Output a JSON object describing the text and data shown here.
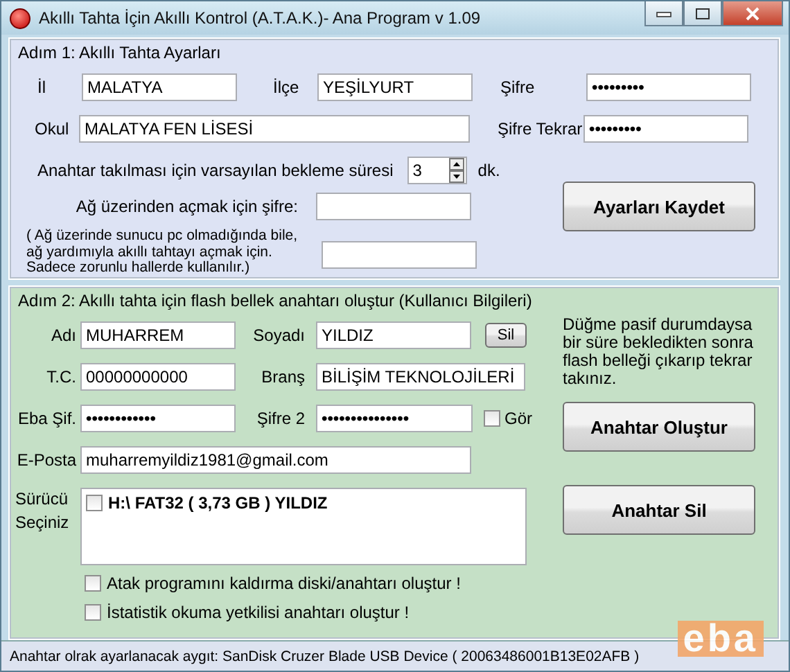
{
  "window": {
    "title": "Akıllı Tahta İçin Akıllı Kontrol (A.T.A.K.)- Ana Program v 1.09"
  },
  "step1": {
    "title": "Adım 1: Akıllı Tahta Ayarları",
    "il": {
      "label": "İl",
      "value": "MALATYA"
    },
    "ilce": {
      "label": "İlçe",
      "value": "YEŞİLYURT"
    },
    "sifre": {
      "label": "Şifre",
      "value": "•••••••••"
    },
    "okul": {
      "label": "Okul",
      "value": "MALATYA FEN LİSESİ"
    },
    "sifre_tekrar": {
      "label": "Şifre Tekrar",
      "value": "•••••••••"
    },
    "wait": {
      "label": "Anahtar takılması için varsayılan bekleme süresi",
      "value": "3",
      "unit": "dk."
    },
    "network": {
      "label": "Ağ üzerinden açmak için şifre:",
      "note": "( Ağ üzerinde sunucu pc olmadığında bile, ağ yardımıyla akıllı tahtayı açmak için. Sadece zorunlu hallerde kullanılır.)"
    },
    "save_button": "Ayarları Kaydet"
  },
  "step2": {
    "title": "Adım 2: Akıllı tahta için flash bellek anahtarı oluştur (Kullanıcı Bilgileri)",
    "adi": {
      "label": "Adı",
      "value": "MUHARREM"
    },
    "soyadi": {
      "label": "Soyadı",
      "value": "YILDIZ"
    },
    "clear_button": "Sil",
    "tc": {
      "label": "T.C.",
      "value": "00000000000"
    },
    "brans": {
      "label": "Branş",
      "value": "BİLİŞİM TEKNOLOJİLERİ"
    },
    "eba_sifre": {
      "label": "Eba Şif.",
      "value": "••••••••••••"
    },
    "sifre2": {
      "label": "Şifre 2",
      "value": "•••••••••••••••"
    },
    "show_password": {
      "label": "Gör",
      "checked": false
    },
    "eposta": {
      "label": "E-Posta",
      "value": "muharremyildiz1981@gmail.com"
    },
    "note": "Düğme pasif durumdaysa bir süre bekledikten sonra flash belleği çıkarıp tekrar takınız.",
    "create_button": "Anahtar Oluştur",
    "drive": {
      "label": "Sürücü Seçiniz",
      "items": [
        {
          "label": "H:\\ FAT32 ( 3,73 GB ) YILDIZ",
          "checked": false
        }
      ]
    },
    "delete_button": "Anahtar Sil",
    "options": [
      {
        "label": "Atak programını kaldırma diski/anahtarı oluştur !",
        "checked": false
      },
      {
        "label": "İstatistik okuma yetkilisi anahtarı oluştur !",
        "checked": false
      }
    ]
  },
  "logo": "eba",
  "status_bar": "Anahtar olrak ayarlanacak aygıt: SanDisk Cruzer Blade USB Device ( 20063486001B13E02AFB )"
}
